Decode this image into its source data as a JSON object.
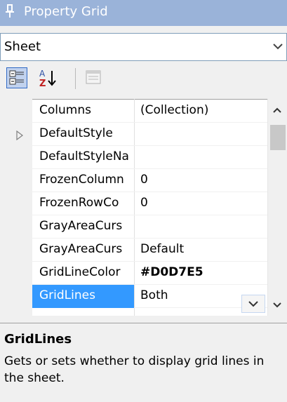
{
  "titlebar": {
    "title": "Property Grid",
    "icon": "pin-icon"
  },
  "selector": {
    "value": "Sheet"
  },
  "toolbar": {
    "buttons": [
      {
        "name": "categorized-view",
        "icon": "categorized-icon",
        "active": true
      },
      {
        "name": "alphabetical-sort",
        "icon": "sort-az-icon",
        "active": false
      },
      {
        "name": "property-pages",
        "icon": "property-pages-icon",
        "active": false
      }
    ]
  },
  "grid": {
    "rows": [
      {
        "name": "Columns",
        "value": "(Collection)"
      },
      {
        "name": "DefaultStyle",
        "value": "",
        "expandable": true
      },
      {
        "name": "DefaultStyleNa",
        "value": ""
      },
      {
        "name": "FrozenColumn",
        "value": "0"
      },
      {
        "name": "FrozenRowCo",
        "value": "0"
      },
      {
        "name": "GrayAreaCurs",
        "value": ""
      },
      {
        "name": "GrayAreaCurs",
        "value": "Default"
      },
      {
        "name": "GridLineColor",
        "value": "#D0D7E5",
        "bold": true
      },
      {
        "name": "GridLines",
        "value": "Both",
        "selected": true
      }
    ]
  },
  "help": {
    "title": "GridLines",
    "description": "Gets or sets whether to display grid lines in the sheet."
  },
  "colors": {
    "titlebar": "#9ab3d9",
    "selection": "#3399ff"
  }
}
